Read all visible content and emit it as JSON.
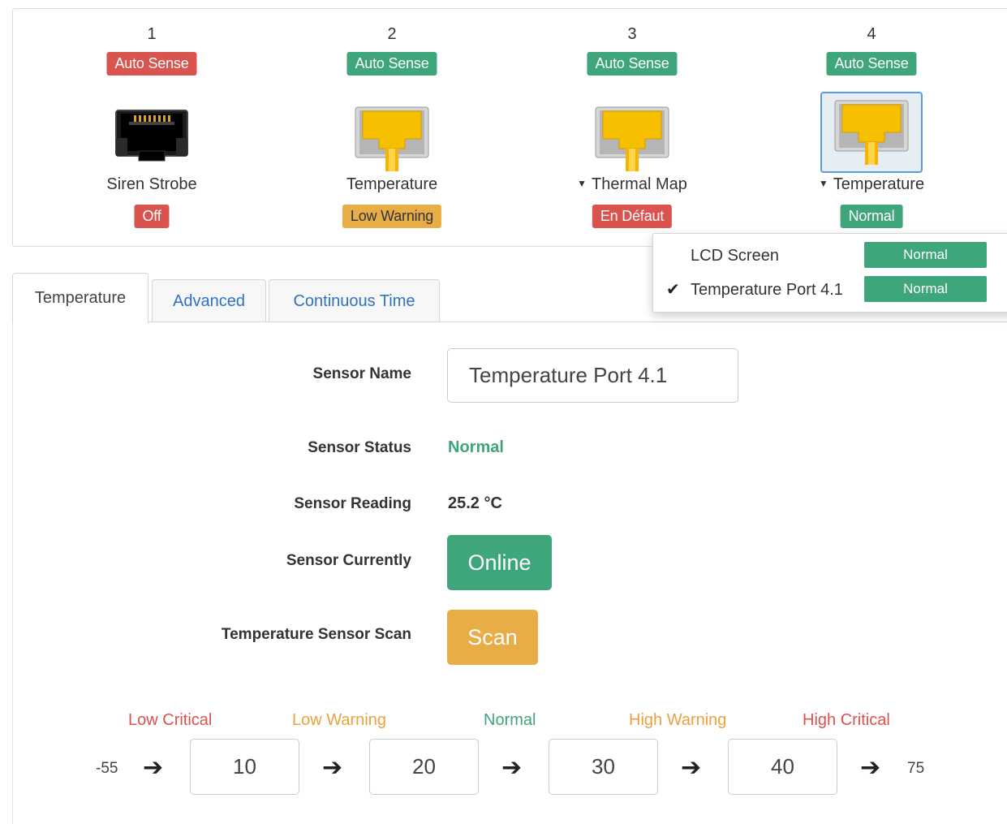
{
  "ports": [
    {
      "number": "1",
      "mode": "Auto Sense",
      "mode_color": "#d9534f",
      "sensor": "Siren Strobe",
      "status": "Off",
      "status_color": "#d9534f",
      "icon": "rj45-empty-icon",
      "has_menu": false
    },
    {
      "number": "2",
      "mode": "Auto Sense",
      "mode_color": "#3fa57a",
      "sensor": "Temperature",
      "status": "Low Warning",
      "status_color": "#e9ad48",
      "icon": "rj45-plugged-icon",
      "has_menu": false
    },
    {
      "number": "3",
      "mode": "Auto Sense",
      "mode_color": "#3fa57a",
      "sensor": "Thermal Map",
      "status": "En Défaut",
      "status_color": "#d9534f",
      "icon": "rj45-plugged-icon",
      "has_menu": true
    },
    {
      "number": "4",
      "mode": "Auto Sense",
      "mode_color": "#3fa57a",
      "sensor": "Temperature",
      "status": "Normal",
      "status_color": "#3fa57a",
      "icon": "rj45-plugged-icon",
      "has_menu": true,
      "selected": true
    }
  ],
  "dropdown": {
    "items": [
      {
        "label": "LCD Screen",
        "status": "Normal",
        "checked": false
      },
      {
        "label": "Temperature Port 4.1",
        "status": "Normal",
        "checked": true
      }
    ]
  },
  "tabs": [
    {
      "label": "Temperature",
      "active": true
    },
    {
      "label": "Advanced",
      "active": false
    },
    {
      "label": "Continuous Time",
      "active": false
    }
  ],
  "form": {
    "sensor_name_label": "Sensor Name",
    "sensor_name_value": "Temperature Port 4.1",
    "sensor_status_label": "Sensor Status",
    "sensor_status_value": "Normal",
    "sensor_reading_label": "Sensor Reading",
    "sensor_reading_value": "25.2 °C",
    "sensor_currently_label": "Sensor Currently",
    "online_button": "Online",
    "scan_label": "Temperature Sensor Scan",
    "scan_button": "Scan"
  },
  "thresholds": {
    "labels": [
      "Low Critical",
      "Low Warning",
      "Normal",
      "High Warning",
      "High Critical"
    ],
    "min": "-55",
    "max": "75",
    "values": [
      "10",
      "20",
      "30",
      "40"
    ],
    "arrow": "➔"
  },
  "colors": {
    "green": "#3fa57a",
    "red": "#d9534f",
    "orange": "#e9ad48",
    "link_blue": "#2f72c3"
  }
}
